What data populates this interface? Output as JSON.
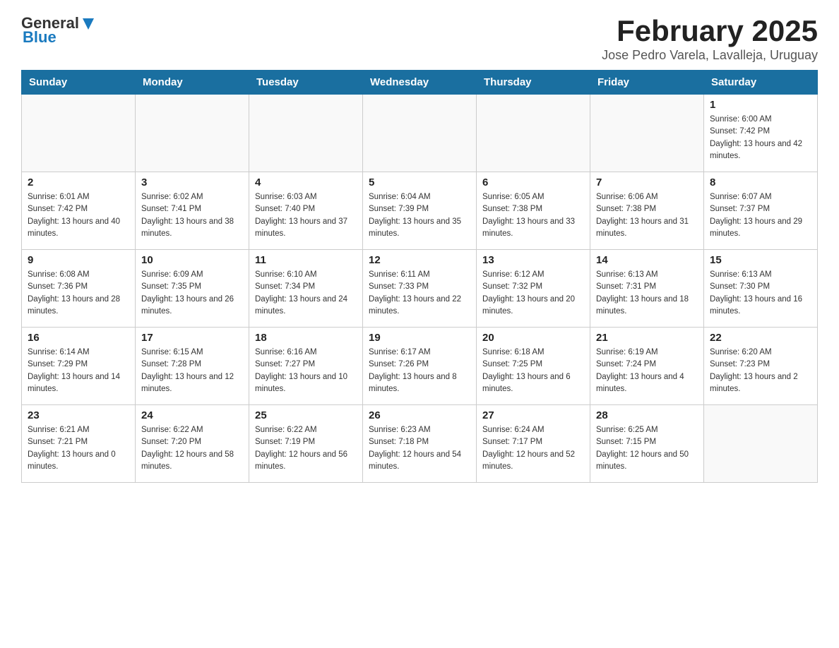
{
  "logo": {
    "general": "General",
    "blue": "Blue"
  },
  "title": "February 2025",
  "subtitle": "Jose Pedro Varela, Lavalleja, Uruguay",
  "days_of_week": [
    "Sunday",
    "Monday",
    "Tuesday",
    "Wednesday",
    "Thursday",
    "Friday",
    "Saturday"
  ],
  "weeks": [
    [
      {
        "day": "",
        "sunrise": "",
        "sunset": "",
        "daylight": ""
      },
      {
        "day": "",
        "sunrise": "",
        "sunset": "",
        "daylight": ""
      },
      {
        "day": "",
        "sunrise": "",
        "sunset": "",
        "daylight": ""
      },
      {
        "day": "",
        "sunrise": "",
        "sunset": "",
        "daylight": ""
      },
      {
        "day": "",
        "sunrise": "",
        "sunset": "",
        "daylight": ""
      },
      {
        "day": "",
        "sunrise": "",
        "sunset": "",
        "daylight": ""
      },
      {
        "day": "1",
        "sunrise": "Sunrise: 6:00 AM",
        "sunset": "Sunset: 7:42 PM",
        "daylight": "Daylight: 13 hours and 42 minutes."
      }
    ],
    [
      {
        "day": "2",
        "sunrise": "Sunrise: 6:01 AM",
        "sunset": "Sunset: 7:42 PM",
        "daylight": "Daylight: 13 hours and 40 minutes."
      },
      {
        "day": "3",
        "sunrise": "Sunrise: 6:02 AM",
        "sunset": "Sunset: 7:41 PM",
        "daylight": "Daylight: 13 hours and 38 minutes."
      },
      {
        "day": "4",
        "sunrise": "Sunrise: 6:03 AM",
        "sunset": "Sunset: 7:40 PM",
        "daylight": "Daylight: 13 hours and 37 minutes."
      },
      {
        "day": "5",
        "sunrise": "Sunrise: 6:04 AM",
        "sunset": "Sunset: 7:39 PM",
        "daylight": "Daylight: 13 hours and 35 minutes."
      },
      {
        "day": "6",
        "sunrise": "Sunrise: 6:05 AM",
        "sunset": "Sunset: 7:38 PM",
        "daylight": "Daylight: 13 hours and 33 minutes."
      },
      {
        "day": "7",
        "sunrise": "Sunrise: 6:06 AM",
        "sunset": "Sunset: 7:38 PM",
        "daylight": "Daylight: 13 hours and 31 minutes."
      },
      {
        "day": "8",
        "sunrise": "Sunrise: 6:07 AM",
        "sunset": "Sunset: 7:37 PM",
        "daylight": "Daylight: 13 hours and 29 minutes."
      }
    ],
    [
      {
        "day": "9",
        "sunrise": "Sunrise: 6:08 AM",
        "sunset": "Sunset: 7:36 PM",
        "daylight": "Daylight: 13 hours and 28 minutes."
      },
      {
        "day": "10",
        "sunrise": "Sunrise: 6:09 AM",
        "sunset": "Sunset: 7:35 PM",
        "daylight": "Daylight: 13 hours and 26 minutes."
      },
      {
        "day": "11",
        "sunrise": "Sunrise: 6:10 AM",
        "sunset": "Sunset: 7:34 PM",
        "daylight": "Daylight: 13 hours and 24 minutes."
      },
      {
        "day": "12",
        "sunrise": "Sunrise: 6:11 AM",
        "sunset": "Sunset: 7:33 PM",
        "daylight": "Daylight: 13 hours and 22 minutes."
      },
      {
        "day": "13",
        "sunrise": "Sunrise: 6:12 AM",
        "sunset": "Sunset: 7:32 PM",
        "daylight": "Daylight: 13 hours and 20 minutes."
      },
      {
        "day": "14",
        "sunrise": "Sunrise: 6:13 AM",
        "sunset": "Sunset: 7:31 PM",
        "daylight": "Daylight: 13 hours and 18 minutes."
      },
      {
        "day": "15",
        "sunrise": "Sunrise: 6:13 AM",
        "sunset": "Sunset: 7:30 PM",
        "daylight": "Daylight: 13 hours and 16 minutes."
      }
    ],
    [
      {
        "day": "16",
        "sunrise": "Sunrise: 6:14 AM",
        "sunset": "Sunset: 7:29 PM",
        "daylight": "Daylight: 13 hours and 14 minutes."
      },
      {
        "day": "17",
        "sunrise": "Sunrise: 6:15 AM",
        "sunset": "Sunset: 7:28 PM",
        "daylight": "Daylight: 13 hours and 12 minutes."
      },
      {
        "day": "18",
        "sunrise": "Sunrise: 6:16 AM",
        "sunset": "Sunset: 7:27 PM",
        "daylight": "Daylight: 13 hours and 10 minutes."
      },
      {
        "day": "19",
        "sunrise": "Sunrise: 6:17 AM",
        "sunset": "Sunset: 7:26 PM",
        "daylight": "Daylight: 13 hours and 8 minutes."
      },
      {
        "day": "20",
        "sunrise": "Sunrise: 6:18 AM",
        "sunset": "Sunset: 7:25 PM",
        "daylight": "Daylight: 13 hours and 6 minutes."
      },
      {
        "day": "21",
        "sunrise": "Sunrise: 6:19 AM",
        "sunset": "Sunset: 7:24 PM",
        "daylight": "Daylight: 13 hours and 4 minutes."
      },
      {
        "day": "22",
        "sunrise": "Sunrise: 6:20 AM",
        "sunset": "Sunset: 7:23 PM",
        "daylight": "Daylight: 13 hours and 2 minutes."
      }
    ],
    [
      {
        "day": "23",
        "sunrise": "Sunrise: 6:21 AM",
        "sunset": "Sunset: 7:21 PM",
        "daylight": "Daylight: 13 hours and 0 minutes."
      },
      {
        "day": "24",
        "sunrise": "Sunrise: 6:22 AM",
        "sunset": "Sunset: 7:20 PM",
        "daylight": "Daylight: 12 hours and 58 minutes."
      },
      {
        "day": "25",
        "sunrise": "Sunrise: 6:22 AM",
        "sunset": "Sunset: 7:19 PM",
        "daylight": "Daylight: 12 hours and 56 minutes."
      },
      {
        "day": "26",
        "sunrise": "Sunrise: 6:23 AM",
        "sunset": "Sunset: 7:18 PM",
        "daylight": "Daylight: 12 hours and 54 minutes."
      },
      {
        "day": "27",
        "sunrise": "Sunrise: 6:24 AM",
        "sunset": "Sunset: 7:17 PM",
        "daylight": "Daylight: 12 hours and 52 minutes."
      },
      {
        "day": "28",
        "sunrise": "Sunrise: 6:25 AM",
        "sunset": "Sunset: 7:15 PM",
        "daylight": "Daylight: 12 hours and 50 minutes."
      },
      {
        "day": "",
        "sunrise": "",
        "sunset": "",
        "daylight": ""
      }
    ]
  ]
}
